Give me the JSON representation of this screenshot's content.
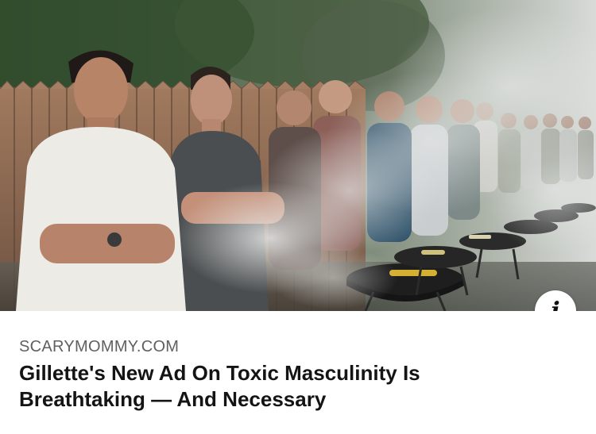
{
  "link_preview": {
    "image_alt": "Men standing in a row behind smoking barbecue grills with arms crossed",
    "source_domain": "SCARYMOMMY.COM",
    "headline_lines": [
      "Gillette's New Ad On Toxic Masculinity Is",
      "Breathtaking — And Necessary"
    ],
    "info_glyph": "i",
    "info_icon": "info-icon"
  },
  "colors": {
    "background": "#ffffff",
    "source_text": "#606060",
    "headline_text": "#141414"
  }
}
